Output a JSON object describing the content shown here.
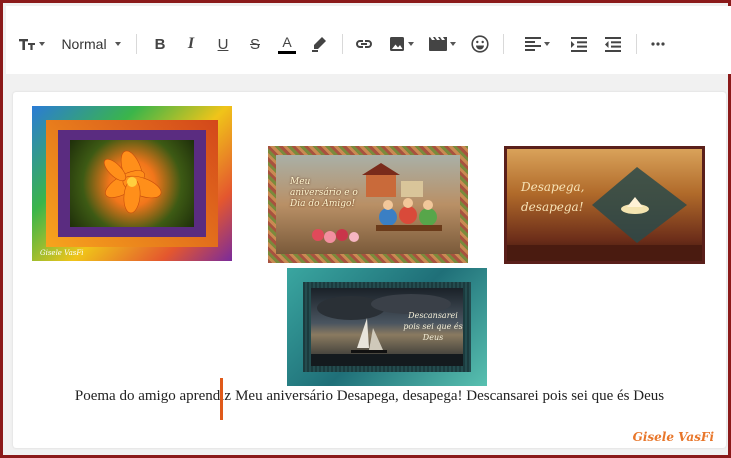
{
  "toolbar": {
    "text_style_icon": "font-size-icon",
    "heading_select": "Normal",
    "bold_label": "B",
    "italic_label": "I",
    "underline_label": "U",
    "strike_label": "S",
    "text_color_label": "A",
    "text_color_value": "#000000",
    "icons": [
      "font-size-icon",
      "bold-icon",
      "italic-icon",
      "underline-icon",
      "strikethrough-icon",
      "text-color-icon",
      "highlight-icon",
      "link-icon",
      "image-icon",
      "video-icon",
      "emoji-icon",
      "align-left-icon",
      "indent-icon",
      "outdent-icon",
      "more-icon"
    ]
  },
  "editor": {
    "images": [
      {
        "name": "flower-frame-image",
        "caption": "Gisele VasFi"
      },
      {
        "name": "meu-aniversario-image",
        "caption": "Meu aniversário e o Dia do Amigo!"
      },
      {
        "name": "desapega-image",
        "caption": "Desapega, desapega!"
      },
      {
        "name": "descansarei-image",
        "caption": "Descansarei pois sei que és Deus"
      }
    ],
    "body_text_before_cursor": "Poema do amigo aprendiz",
    "body_text_after_cursor": "Meu aniversário Desapega, desapega! Descansarei pois sei que és Deus",
    "signature": "Gisele VasFi"
  },
  "colors": {
    "frame_border": "#8b1a1a",
    "cursor": "#e05a1a",
    "signature": "#e8762a"
  }
}
